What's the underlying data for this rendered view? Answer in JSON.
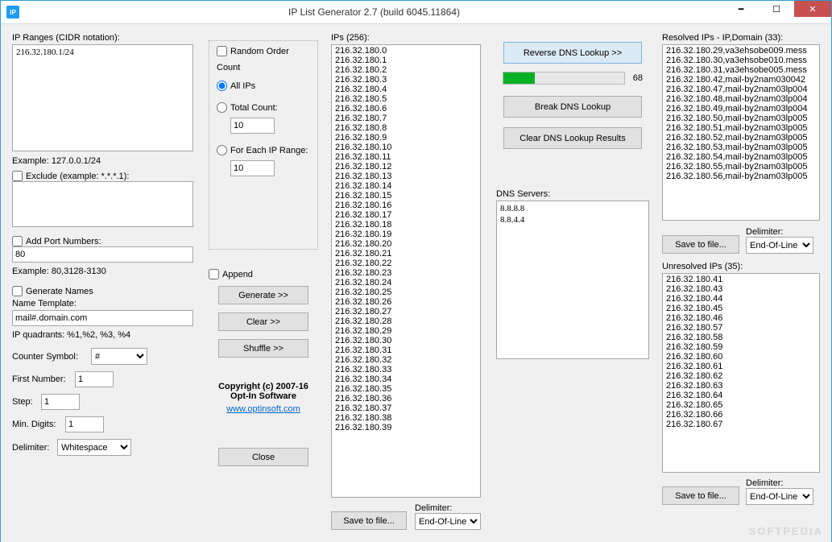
{
  "window": {
    "title": "IP List Generator 2.7 (build 6045.11864)",
    "icon": "IP"
  },
  "col1": {
    "ipranges_label": "IP Ranges (CIDR notation):",
    "ipranges_value": "216.32.180.1/24",
    "example_range": "Example: 127.0.0.1/24",
    "exclude_label": "Exclude (example: *.*.*.1):",
    "exclude_value": "",
    "addport_label": "Add Port Numbers:",
    "port_value": "80",
    "example_port": "Example: 80,3128-3130",
    "generate_names_label": "Generate Names",
    "name_template_label": "Name Template:",
    "name_template_value": "mail#.domain.com",
    "quadrants": "IP quadrants: %1,%2, %3, %4",
    "counter_symbol_label": "Counter Symbol:",
    "counter_symbol_value": "#",
    "first_number_label": "First Number:",
    "first_number_value": "1",
    "step_label": "Step:",
    "step_value": "1",
    "min_digits_label": "Min. Digits:",
    "min_digits_value": "1",
    "delimiter_label": "Delimiter:",
    "delimiter_value": "Whitespace"
  },
  "col2": {
    "random_order": "Random Order",
    "count_legend": "Count",
    "all_ips": "All IPs",
    "total_count": "Total Count:",
    "total_count_value": "10",
    "for_each": "For Each IP Range:",
    "for_each_value": "10",
    "append": "Append",
    "generate": "Generate >>",
    "clear": "Clear >>",
    "shuffle": "Shuffle >>",
    "copyright1": "Copyright (c) 2007-16",
    "copyright2": "Opt-In Software",
    "url": "www.optinsoft.com",
    "close": "Close"
  },
  "col3": {
    "ips_label": "IPs (256):",
    "ips": [
      "216.32.180.0",
      "216.32.180.1",
      "216.32.180.2",
      "216.32.180.3",
      "216.32.180.4",
      "216.32.180.5",
      "216.32.180.6",
      "216.32.180.7",
      "216.32.180.8",
      "216.32.180.9",
      "216.32.180.10",
      "216.32.180.11",
      "216.32.180.12",
      "216.32.180.13",
      "216.32.180.14",
      "216.32.180.15",
      "216.32.180.16",
      "216.32.180.17",
      "216.32.180.18",
      "216.32.180.19",
      "216.32.180.20",
      "216.32.180.21",
      "216.32.180.22",
      "216.32.180.23",
      "216.32.180.24",
      "216.32.180.25",
      "216.32.180.26",
      "216.32.180.27",
      "216.32.180.28",
      "216.32.180.29",
      "216.32.180.30",
      "216.32.180.31",
      "216.32.180.32",
      "216.32.180.33",
      "216.32.180.34",
      "216.32.180.35",
      "216.32.180.36",
      "216.32.180.37",
      "216.32.180.38",
      "216.32.180.39"
    ],
    "save": "Save to file...",
    "delimiter_label": "Delimiter:",
    "delimiter_value": "End-Of-Line"
  },
  "col4": {
    "reverse": "Reverse DNS Lookup >>",
    "progress": "68",
    "break": "Break DNS Lookup",
    "clear": "Clear DNS Lookup Results",
    "dns_label": "DNS Servers:",
    "dns_servers": "8.8.8.8\n8.8.4.4"
  },
  "col5": {
    "resolved_label": "Resolved IPs - IP,Domain (33):",
    "resolved": [
      "216.32.180.29,va3ehsobe009.mess",
      "216.32.180.30,va3ehsobe010.mess",
      "216.32.180.31,va3ehsobe005.mess",
      "216.32.180.42,mail-by2nam030042",
      "216.32.180.47,mail-by2nam03lp004",
      "216.32.180.48,mail-by2nam03lp004",
      "216.32.180.49,mail-by2nam03lp004",
      "216.32.180.50,mail-by2nam03lp005",
      "216.32.180.51,mail-by2nam03lp005",
      "216.32.180.52,mail-by2nam03lp005",
      "216.32.180.53,mail-by2nam03lp005",
      "216.32.180.54,mail-by2nam03lp005",
      "216.32.180.55,mail-by2nam03lp005",
      "216.32.180.56,mail-by2nam03lp005"
    ],
    "save": "Save to file...",
    "delimiter_label": "Delimiter:",
    "delimiter_value": "End-Of-Line",
    "unresolved_label": "Unresolved IPs (35):",
    "unresolved": [
      "216.32.180.41",
      "216.32.180.43",
      "216.32.180.44",
      "216.32.180.45",
      "216.32.180.46",
      "216.32.180.57",
      "216.32.180.58",
      "216.32.180.59",
      "216.32.180.60",
      "216.32.180.61",
      "216.32.180.62",
      "216.32.180.63",
      "216.32.180.64",
      "216.32.180.65",
      "216.32.180.66",
      "216.32.180.67"
    ],
    "save2": "Save to file...",
    "delimiter2_label": "Delimiter:",
    "delimiter2_value": "End-Of-Line"
  },
  "watermark": "SOFTPEDIA"
}
